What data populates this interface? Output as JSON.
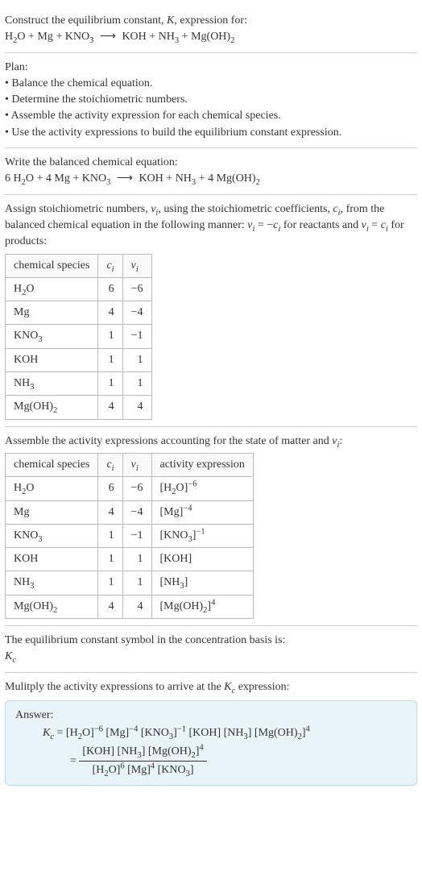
{
  "header": {
    "line1_prefix": "Construct the equilibrium constant, ",
    "K": "K",
    "line1_suffix": ", expression for:",
    "equation_parts": {
      "r1": "H",
      "r1sub": "2",
      "r1b": "O",
      "plus": " + ",
      "r2": "Mg",
      "r3a": "KNO",
      "r3sub": "3",
      "arrow": "⟶",
      "p1": "KOH",
      "p2a": "NH",
      "p2sub": "3",
      "p3a": "Mg(OH)",
      "p3sub": "2"
    }
  },
  "plan": {
    "title": "Plan:",
    "b1": "• Balance the chemical equation.",
    "b2": "• Determine the stoichiometric numbers.",
    "b3": "• Assemble the activity expression for each chemical species.",
    "b4": "• Use the activity expressions to build the equilibrium constant expression."
  },
  "balanced": {
    "title": "Write the balanced chemical equation:",
    "parts": {
      "c1": "6 ",
      "s1a": "H",
      "s1sub": "2",
      "s1b": "O",
      "plus": " + ",
      "c2": "4 ",
      "s2": "Mg",
      "s3a": "KNO",
      "s3sub": "3",
      "arrow": "⟶",
      "p1": "KOH",
      "p2a": "NH",
      "p2sub": "3",
      "c4": "4 ",
      "p3a": "Mg(OH)",
      "p3sub": "2"
    }
  },
  "assign_text": {
    "t1": "Assign stoichiometric numbers, ",
    "nu": "ν",
    "nu_sub": "i",
    "t2": ", using the stoichiometric coefficients, ",
    "c": "c",
    "c_sub": "i",
    "t3": ", from the balanced chemical equation in the following manner: ",
    "rel1a": "ν",
    "rel1b": "i",
    "rel1eq": " = −",
    "rel1c": "c",
    "rel1d": "i",
    "t4": " for reactants and ",
    "rel2a": "ν",
    "rel2b": "i",
    "rel2eq": " = ",
    "rel2c": "c",
    "rel2d": "i",
    "t5": " for products:"
  },
  "table1": {
    "headers": {
      "h1": "chemical species",
      "h2_a": "c",
      "h2_b": "i",
      "h3_a": "ν",
      "h3_b": "i"
    },
    "rows": [
      {
        "sp_a": "H",
        "sp_sub": "2",
        "sp_b": "O",
        "c": "6",
        "v": "−6"
      },
      {
        "sp_a": "Mg",
        "sp_sub": "",
        "sp_b": "",
        "c": "4",
        "v": "−4"
      },
      {
        "sp_a": "KNO",
        "sp_sub": "3",
        "sp_b": "",
        "c": "1",
        "v": "−1"
      },
      {
        "sp_a": "KOH",
        "sp_sub": "",
        "sp_b": "",
        "c": "1",
        "v": "1"
      },
      {
        "sp_a": "NH",
        "sp_sub": "3",
        "sp_b": "",
        "c": "1",
        "v": "1"
      },
      {
        "sp_a": "Mg(OH)",
        "sp_sub": "2",
        "sp_b": "",
        "c": "4",
        "v": "4"
      }
    ]
  },
  "assemble_text": {
    "t1": "Assemble the activity expressions accounting for the state of matter and ",
    "nu": "ν",
    "nu_sub": "i",
    "t2": ":"
  },
  "table2": {
    "headers": {
      "h1": "chemical species",
      "h2_a": "c",
      "h2_b": "i",
      "h3_a": "ν",
      "h3_b": "i",
      "h4": "activity expression"
    },
    "rows": [
      {
        "sp_a": "H",
        "sp_sub": "2",
        "sp_b": "O",
        "c": "6",
        "v": "−6",
        "ax_a": "[H",
        "ax_sub": "2",
        "ax_b": "O]",
        "ax_sup": "−6"
      },
      {
        "sp_a": "Mg",
        "sp_sub": "",
        "sp_b": "",
        "c": "4",
        "v": "−4",
        "ax_a": "[Mg]",
        "ax_sub": "",
        "ax_b": "",
        "ax_sup": "−4"
      },
      {
        "sp_a": "KNO",
        "sp_sub": "3",
        "sp_b": "",
        "c": "1",
        "v": "−1",
        "ax_a": "[KNO",
        "ax_sub": "3",
        "ax_b": "]",
        "ax_sup": "−1"
      },
      {
        "sp_a": "KOH",
        "sp_sub": "",
        "sp_b": "",
        "c": "1",
        "v": "1",
        "ax_a": "[KOH]",
        "ax_sub": "",
        "ax_b": "",
        "ax_sup": ""
      },
      {
        "sp_a": "NH",
        "sp_sub": "3",
        "sp_b": "",
        "c": "1",
        "v": "1",
        "ax_a": "[NH",
        "ax_sub": "3",
        "ax_b": "]",
        "ax_sup": ""
      },
      {
        "sp_a": "Mg(OH)",
        "sp_sub": "2",
        "sp_b": "",
        "c": "4",
        "v": "4",
        "ax_a": "[Mg(OH)",
        "ax_sub": "2",
        "ax_b": "]",
        "ax_sup": "4"
      }
    ]
  },
  "symbol": {
    "t1": "The equilibrium constant symbol in the concentration basis is:",
    "K": "K",
    "Ksub": "c"
  },
  "mult": {
    "t1": "Mulitply the activity expressions to arrive at the ",
    "K": "K",
    "Ksub": "c",
    "t2": " expression:"
  },
  "answer": {
    "title": "Answer:",
    "lhs_K": "K",
    "lhs_sub": "c",
    "eq": " = ",
    "line1": {
      "p": [
        {
          "a": "[H",
          "sub": "2",
          "b": "O]",
          "sup": "−6"
        },
        {
          "a": " [Mg]",
          "sub": "",
          "b": "",
          "sup": "−4"
        },
        {
          "a": " [KNO",
          "sub": "3",
          "b": "]",
          "sup": "−1"
        },
        {
          "a": " [KOH]",
          "sub": "",
          "b": "",
          "sup": ""
        },
        {
          "a": " [NH",
          "sub": "3",
          "b": "]",
          "sup": ""
        },
        {
          "a": " [Mg(OH)",
          "sub": "2",
          "b": "]",
          "sup": "4"
        }
      ]
    },
    "eq2": "= ",
    "frac": {
      "num": [
        {
          "a": "[KOH]",
          "sub": "",
          "b": "",
          "sup": ""
        },
        {
          "a": " [NH",
          "sub": "3",
          "b": "]",
          "sup": ""
        },
        {
          "a": " [Mg(OH)",
          "sub": "2",
          "b": "]",
          "sup": "4"
        }
      ],
      "den": [
        {
          "a": "[H",
          "sub": "2",
          "b": "O]",
          "sup": "6"
        },
        {
          "a": " [Mg]",
          "sub": "",
          "b": "",
          "sup": "4"
        },
        {
          "a": " [KNO",
          "sub": "3",
          "b": "]",
          "sup": ""
        }
      ]
    }
  }
}
